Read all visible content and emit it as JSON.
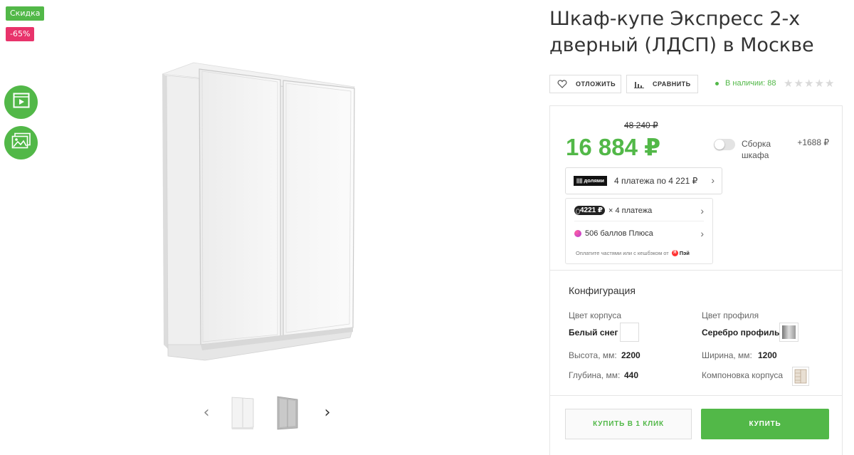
{
  "badges": {
    "sale": "Скидка",
    "discount": "-65%"
  },
  "media": {
    "video_icon": "play-icon",
    "photo_icon": "image-icon"
  },
  "product": {
    "title": "Шкаф-купе Экспресс 2-х дверный (ЛДСП) в Москве",
    "image_name": "wardrobe-image"
  },
  "gallery": {
    "prev": "‹",
    "next": "›",
    "thumbs": [
      "thumb-1",
      "thumb-2"
    ]
  },
  "actions": {
    "postpone": "ОТЛОЖИТЬ",
    "compare": "СРАВНИТЬ"
  },
  "stock": {
    "text": "В наличии: 88"
  },
  "rating": {
    "stars": 0,
    "max": 5
  },
  "price": {
    "old": "48 240 ₽",
    "current": "16 884 ₽",
    "assembly_label": "Сборка шкафа",
    "assembly_price": "+1688 ₽"
  },
  "dolyami": {
    "logo": "|||| долями",
    "text": "4 платежа по 4 221 ₽",
    "chevron": "›"
  },
  "split": {
    "amount": "4221 ₽",
    "text": "× 4 платежа",
    "plus": "506 баллов Плюса",
    "footer": "Оплатите частями или с кешбэком от",
    "logo": "Пэй",
    "logo_letter": "Я"
  },
  "config": {
    "title": "Конфигурация",
    "body_color_label": "Цвет корпуса",
    "body_color_value": "Белый снег",
    "profile_color_label": "Цвет профиля",
    "profile_color_value": "Серебро профиль",
    "height_label": "Высота, мм:",
    "height_value": "2200",
    "width_label": "Ширина, мм:",
    "width_value": "1200",
    "depth_label": "Глубина, мм:",
    "depth_value": "440",
    "layout_label": "Компоновка корпуса"
  },
  "buttons": {
    "one_click": "КУПИТЬ В 1 КЛИК",
    "buy": "КУПИТЬ"
  },
  "colors": {
    "accent": "#52b848",
    "discount": "#e8336b"
  }
}
